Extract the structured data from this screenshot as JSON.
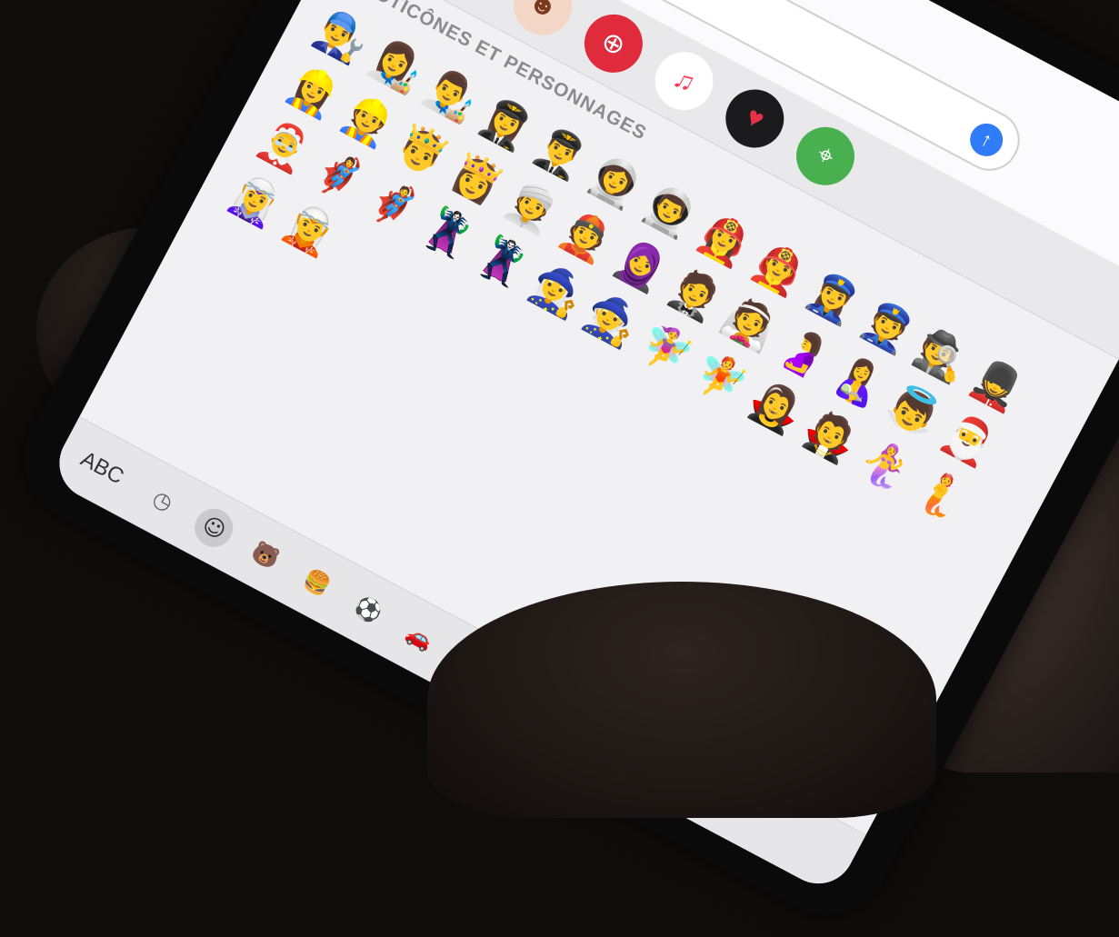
{
  "keyboard": {
    "section_title": "ÉMOTICÔNES ET PERSONNAGES",
    "abc_label": "ABC",
    "categories": [
      {
        "icon": "clock-icon",
        "glyph": "◷"
      },
      {
        "icon": "smiley-icon",
        "glyph": "☺"
      },
      {
        "icon": "bear-icon",
        "glyph": "🐻"
      },
      {
        "icon": "burger-icon",
        "glyph": "🍔"
      },
      {
        "icon": "soccer-ball-icon",
        "glyph": "⚽"
      },
      {
        "icon": "car-icon",
        "glyph": "🚗"
      },
      {
        "icon": "lightbulb-icon",
        "glyph": "💡"
      }
    ],
    "emojis": [
      "👨‍🔧",
      "👩‍🎨",
      "👨‍🎨",
      "👩‍✈️",
      "👨‍✈️",
      "👩‍🚀",
      "👨‍🚀",
      "👩‍🚒",
      "👨‍🚒",
      "👮‍♀️",
      "👮",
      "🕵️",
      "💂",
      "👷‍♀️",
      "👷",
      "🤴",
      "👸",
      "👳",
      "👲",
      "🧕",
      "🤵",
      "👰",
      "🤰",
      "🤱",
      "👼",
      "🎅",
      "🤶",
      "🦸‍♀️",
      "🦸",
      "🦹‍♀️",
      "🦹",
      "🧙‍♀️",
      "🧙",
      "🧚‍♀️",
      "🧚",
      "🧛‍♀️",
      "🧛",
      "🧜‍♀️",
      "🧜",
      "🧝‍♀️",
      "🧝"
    ]
  },
  "messages": {
    "camera_icon": "camera-icon",
    "camera_glyph": "📷",
    "apps_icon": "app-store-icon",
    "apps_glyph": "Ⓐ",
    "send_icon": "arrow-up-icon",
    "send_glyph": "↑"
  },
  "app_strip": [
    {
      "name": "photos-app",
      "icon": "photos-icon",
      "glyph": "✿"
    },
    {
      "name": "app-store-app",
      "icon": "app-store-icon",
      "glyph": "Ⓐ"
    },
    {
      "name": "memoji-app",
      "icon": "memoji-icon",
      "glyph": "☻"
    },
    {
      "name": "image-search-app",
      "icon": "globe-search-icon",
      "glyph": "⊕"
    },
    {
      "name": "music-app",
      "icon": "music-note-icon",
      "glyph": "♫"
    },
    {
      "name": "digital-touch-app",
      "icon": "heart-icon",
      "glyph": "♥"
    },
    {
      "name": "maps-app",
      "icon": "maps-icon",
      "glyph": "⌖"
    }
  ]
}
